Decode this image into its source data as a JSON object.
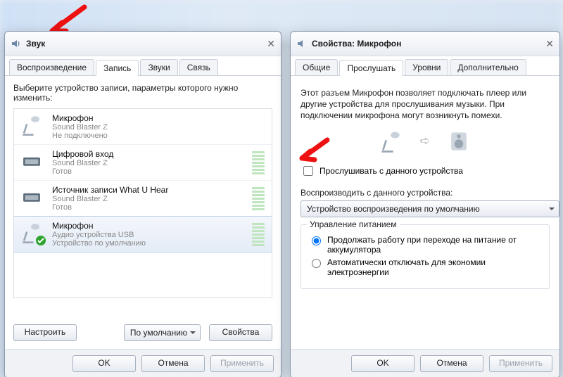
{
  "common": {
    "ok": "OK",
    "cancel": "Отмена",
    "apply": "Применить"
  },
  "left": {
    "title": "Звук",
    "tabs": [
      "Воспроизведение",
      "Запись",
      "Звуки",
      "Связь"
    ],
    "hint": "Выберите устройство записи, параметры которого нужно изменить:",
    "devices": [
      {
        "name": "Микрофон",
        "driver": "Sound Blaster Z",
        "status": "Не подключено"
      },
      {
        "name": "Цифровой вход",
        "driver": "Sound Blaster Z",
        "status": "Готов"
      },
      {
        "name": "Источник записи What U Hear",
        "driver": "Sound Blaster Z",
        "status": "Готов"
      },
      {
        "name": "Микрофон",
        "driver": "Аудио устройства USB",
        "status": "Устройство по умолчанию"
      }
    ],
    "btn_configure": "Настроить",
    "btn_default": "По умолчанию",
    "btn_properties": "Свойства"
  },
  "right": {
    "title": "Свойства: Микрофон",
    "tabs": [
      "Общие",
      "Прослушать",
      "Уровни",
      "Дополнительно"
    ],
    "desc": "Этот разъем Микрофон позволяет подключать плеер или другие устройства для прослушивания музыки. При подключении микрофона могут возникнуть помехи.",
    "listen_label": "Прослушивать с данного устройства",
    "play_through_label": "Воспроизводить с данного устройства:",
    "play_through_value": "Устройство воспроизведения по умолчанию",
    "power": {
      "title": "Управление питанием",
      "opt1": "Продолжать работу при переходе на питание от аккумулятора",
      "opt2": "Автоматически отключать для экономии электроэнергии"
    }
  }
}
